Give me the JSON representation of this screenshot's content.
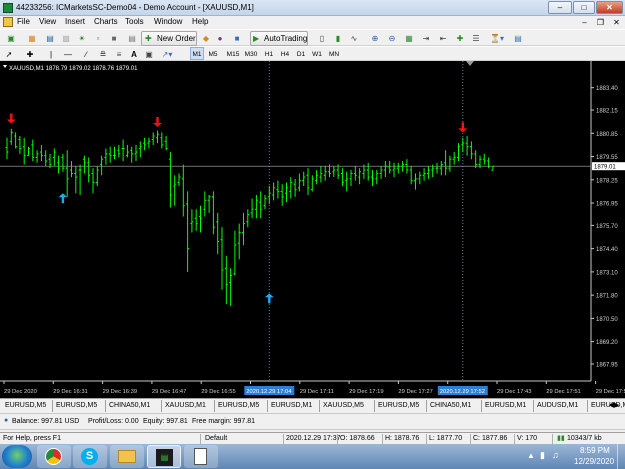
{
  "window": {
    "title": "44233256: ICMarketsSC-Demo04 - Demo Account - [XAUUSD,M1]"
  },
  "menu": [
    "File",
    "View",
    "Insert",
    "Charts",
    "Tools",
    "Window",
    "Help"
  ],
  "toolbar": {
    "new_order": "New Order",
    "autotrading": "AutoTrading",
    "timeframes": [
      "M1",
      "M5",
      "M15",
      "M30",
      "H1",
      "H4",
      "D1",
      "W1",
      "MN"
    ],
    "active_timeframe": "M1"
  },
  "chart_data": {
    "type": "ohlc",
    "title": "XAUUSD,M1  1878.79 1879.02 1878.76 1879.01",
    "colors": {
      "background": "#000000",
      "bars": "#00ff00",
      "grid": "#5a7f9c",
      "up_arrow": "#1ea9f0",
      "down_arrow": "#ff1010",
      "price_line": "#b0b0b0"
    },
    "ylim": [
      1867.0,
      1884.5
    ],
    "y_ticks": [
      "1883.40",
      "1882.15",
      "1880.85",
      "1879.55",
      "1878.25",
      "1876.95",
      "1875.70",
      "1874.40",
      "1873.10",
      "1871.80",
      "1870.50",
      "1869.20",
      "1867.95"
    ],
    "current_price": "1879.01",
    "x_ticks": [
      "29 Dec 2020",
      "29 Dec 16:31",
      "29 Dec 16:39",
      "29 Dec 16:47",
      "29 Dec 16:55",
      "29 Dec 17:03",
      "29 Dec 17:11",
      "29 Dec 17:19",
      "29 Dec 17:27",
      "29 Dec 17:35",
      "29 Dec 17:43",
      "29 Dec 17:51",
      "29 Dec 17:59"
    ],
    "x_highlights": [
      "2020.12.29 17:04",
      "2020.12.29 17:52"
    ],
    "vertical_markers": [
      61,
      106
    ],
    "bars": [
      {
        "o": 1880.05,
        "h": 1880.6,
        "l": 1879.4,
        "c": 1879.8
      },
      {
        "o": 1880.4,
        "h": 1881.1,
        "l": 1880.2,
        "c": 1880.9
      },
      {
        "o": 1880.7,
        "h": 1880.9,
        "l": 1880.0,
        "c": 1880.1
      },
      {
        "o": 1880.5,
        "h": 1880.7,
        "l": 1879.7,
        "c": 1880.0
      },
      {
        "o": 1880.1,
        "h": 1880.6,
        "l": 1879.1,
        "c": 1879.6
      },
      {
        "o": 1879.6,
        "h": 1880.1,
        "l": 1879.6,
        "c": 1880.0
      },
      {
        "o": 1880.2,
        "h": 1880.5,
        "l": 1879.3,
        "c": 1879.5
      },
      {
        "o": 1879.5,
        "h": 1879.9,
        "l": 1879.2,
        "c": 1879.7
      },
      {
        "o": 1879.8,
        "h": 1880.2,
        "l": 1879.3,
        "c": 1879.6
      },
      {
        "o": 1879.6,
        "h": 1879.9,
        "l": 1879.0,
        "c": 1879.3
      },
      {
        "o": 1879.4,
        "h": 1879.7,
        "l": 1878.9,
        "c": 1879.1
      },
      {
        "o": 1879.5,
        "h": 1880.0,
        "l": 1879.0,
        "c": 1879.8
      },
      {
        "o": 1879.2,
        "h": 1879.6,
        "l": 1878.6,
        "c": 1878.9
      },
      {
        "o": 1879.5,
        "h": 1879.7,
        "l": 1878.7,
        "c": 1878.9
      },
      {
        "o": 1878.9,
        "h": 1879.9,
        "l": 1877.3,
        "c": 1878.3
      },
      {
        "o": 1878.8,
        "h": 1879.3,
        "l": 1878.4,
        "c": 1878.6
      },
      {
        "o": 1878.6,
        "h": 1879.0,
        "l": 1877.5,
        "c": 1878.4
      },
      {
        "o": 1878.8,
        "h": 1879.1,
        "l": 1877.4,
        "c": 1878.8
      },
      {
        "o": 1879.4,
        "h": 1879.6,
        "l": 1878.6,
        "c": 1879.2
      },
      {
        "o": 1879.2,
        "h": 1879.5,
        "l": 1878.1,
        "c": 1878.5
      },
      {
        "o": 1878.6,
        "h": 1878.9,
        "l": 1877.5,
        "c": 1878.1
      },
      {
        "o": 1878.1,
        "h": 1879.0,
        "l": 1877.9,
        "c": 1878.8
      },
      {
        "o": 1879.1,
        "h": 1879.6,
        "l": 1878.5,
        "c": 1879.4
      },
      {
        "o": 1879.5,
        "h": 1880.0,
        "l": 1879.1,
        "c": 1879.7
      },
      {
        "o": 1879.7,
        "h": 1880.1,
        "l": 1879.2,
        "c": 1879.6
      },
      {
        "o": 1879.6,
        "h": 1880.1,
        "l": 1879.4,
        "c": 1879.6
      },
      {
        "o": 1879.9,
        "h": 1880.2,
        "l": 1879.5,
        "c": 1879.7
      },
      {
        "o": 1880.0,
        "h": 1880.5,
        "l": 1879.3,
        "c": 1880.0
      },
      {
        "o": 1879.6,
        "h": 1880.2,
        "l": 1879.5,
        "c": 1879.8
      },
      {
        "o": 1879.9,
        "h": 1880.1,
        "l": 1879.2,
        "c": 1879.7
      },
      {
        "o": 1879.7,
        "h": 1880.2,
        "l": 1879.3,
        "c": 1879.8
      },
      {
        "o": 1880.0,
        "h": 1880.4,
        "l": 1879.5,
        "c": 1880.1
      },
      {
        "o": 1880.3,
        "h": 1880.6,
        "l": 1879.9,
        "c": 1880.2
      },
      {
        "o": 1880.3,
        "h": 1880.6,
        "l": 1880.0,
        "c": 1880.4
      },
      {
        "o": 1880.5,
        "h": 1880.9,
        "l": 1880.2,
        "c": 1880.7
      },
      {
        "o": 1880.6,
        "h": 1881.0,
        "l": 1880.3,
        "c": 1880.8
      },
      {
        "o": 1880.6,
        "h": 1880.9,
        "l": 1880.0,
        "c": 1880.2
      },
      {
        "o": 1880.4,
        "h": 1880.7,
        "l": 1879.9,
        "c": 1880.0
      },
      {
        "o": 1879.4,
        "h": 1879.8,
        "l": 1876.7,
        "c": 1877.4
      },
      {
        "o": 1877.9,
        "h": 1878.5,
        "l": 1876.8,
        "c": 1878.0
      },
      {
        "o": 1878.1,
        "h": 1878.6,
        "l": 1877.9,
        "c": 1878.4
      },
      {
        "o": 1878.3,
        "h": 1879.1,
        "l": 1876.2,
        "c": 1876.8
      },
      {
        "o": 1876.9,
        "h": 1877.6,
        "l": 1873.1,
        "c": 1874.4
      },
      {
        "o": 1875.8,
        "h": 1876.6,
        "l": 1875.3,
        "c": 1875.9
      },
      {
        "o": 1876.1,
        "h": 1876.6,
        "l": 1875.4,
        "c": 1875.8
      },
      {
        "o": 1876.2,
        "h": 1876.8,
        "l": 1875.3,
        "c": 1876.1
      },
      {
        "o": 1876.6,
        "h": 1877.6,
        "l": 1876.2,
        "c": 1877.1
      },
      {
        "o": 1877.1,
        "h": 1877.4,
        "l": 1876.4,
        "c": 1877.3
      },
      {
        "o": 1877.3,
        "h": 1877.6,
        "l": 1875.2,
        "c": 1875.6
      },
      {
        "o": 1875.9,
        "h": 1876.4,
        "l": 1874.1,
        "c": 1874.8
      },
      {
        "o": 1874.9,
        "h": 1875.6,
        "l": 1872.1,
        "c": 1873.2
      },
      {
        "o": 1873.3,
        "h": 1874.0,
        "l": 1871.3,
        "c": 1872.4
      },
      {
        "o": 1872.5,
        "h": 1873.3,
        "l": 1871.2,
        "c": 1872.9
      },
      {
        "o": 1873.0,
        "h": 1875.4,
        "l": 1872.9,
        "c": 1874.6
      },
      {
        "o": 1874.7,
        "h": 1875.8,
        "l": 1873.8,
        "c": 1875.3
      },
      {
        "o": 1875.3,
        "h": 1876.4,
        "l": 1874.6,
        "c": 1875.8
      },
      {
        "o": 1875.9,
        "h": 1876.6,
        "l": 1875.6,
        "c": 1876.3
      },
      {
        "o": 1876.4,
        "h": 1877.2,
        "l": 1876.1,
        "c": 1876.6
      },
      {
        "o": 1876.6,
        "h": 1877.4,
        "l": 1876.1,
        "c": 1877.1
      },
      {
        "o": 1877.0,
        "h": 1877.6,
        "l": 1876.1,
        "c": 1876.6
      },
      {
        "o": 1876.8,
        "h": 1877.4,
        "l": 1876.6,
        "c": 1877.2
      },
      {
        "o": 1877.3,
        "h": 1877.9,
        "l": 1876.9,
        "c": 1877.5
      },
      {
        "o": 1877.4,
        "h": 1878.1,
        "l": 1877.1,
        "c": 1877.8
      },
      {
        "o": 1877.7,
        "h": 1878.2,
        "l": 1877.2,
        "c": 1877.6
      },
      {
        "o": 1877.6,
        "h": 1878.0,
        "l": 1876.8,
        "c": 1877.3
      },
      {
        "o": 1877.5,
        "h": 1878.1,
        "l": 1877.0,
        "c": 1877.8
      },
      {
        "o": 1877.6,
        "h": 1878.4,
        "l": 1877.2,
        "c": 1878.1
      },
      {
        "o": 1878.0,
        "h": 1878.3,
        "l": 1877.3,
        "c": 1877.7
      },
      {
        "o": 1877.8,
        "h": 1878.6,
        "l": 1877.6,
        "c": 1878.2
      },
      {
        "o": 1878.2,
        "h": 1878.7,
        "l": 1877.9,
        "c": 1878.4
      },
      {
        "o": 1878.5,
        "h": 1878.9,
        "l": 1877.4,
        "c": 1877.8
      },
      {
        "o": 1877.7,
        "h": 1878.5,
        "l": 1877.6,
        "c": 1878.3
      },
      {
        "o": 1878.2,
        "h": 1878.8,
        "l": 1878.0,
        "c": 1878.5
      },
      {
        "o": 1878.4,
        "h": 1879.0,
        "l": 1878.1,
        "c": 1878.6
      },
      {
        "o": 1878.5,
        "h": 1879.0,
        "l": 1878.2,
        "c": 1878.7
      },
      {
        "o": 1878.7,
        "h": 1879.1,
        "l": 1878.4,
        "c": 1878.6
      },
      {
        "o": 1878.7,
        "h": 1879.0,
        "l": 1878.4,
        "c": 1878.8
      },
      {
        "o": 1878.8,
        "h": 1879.1,
        "l": 1878.3,
        "c": 1878.5
      },
      {
        "o": 1878.6,
        "h": 1878.9,
        "l": 1877.9,
        "c": 1878.1
      },
      {
        "o": 1878.2,
        "h": 1878.7,
        "l": 1877.6,
        "c": 1878.3
      },
      {
        "o": 1878.3,
        "h": 1878.8,
        "l": 1877.9,
        "c": 1878.6
      },
      {
        "o": 1878.6,
        "h": 1879.0,
        "l": 1878.2,
        "c": 1878.5
      },
      {
        "o": 1878.4,
        "h": 1878.9,
        "l": 1878.0,
        "c": 1878.7
      },
      {
        "o": 1878.6,
        "h": 1879.1,
        "l": 1878.3,
        "c": 1878.8
      },
      {
        "o": 1878.8,
        "h": 1879.2,
        "l": 1878.2,
        "c": 1878.4
      },
      {
        "o": 1878.4,
        "h": 1878.8,
        "l": 1877.9,
        "c": 1878.3
      },
      {
        "o": 1878.3,
        "h": 1878.8,
        "l": 1878.0,
        "c": 1878.6
      },
      {
        "o": 1878.6,
        "h": 1879.0,
        "l": 1878.3,
        "c": 1878.8
      },
      {
        "o": 1878.8,
        "h": 1879.3,
        "l": 1878.4,
        "c": 1879.0
      },
      {
        "o": 1879.0,
        "h": 1879.3,
        "l": 1878.6,
        "c": 1878.8
      },
      {
        "o": 1878.8,
        "h": 1879.2,
        "l": 1878.4,
        "c": 1878.9
      },
      {
        "o": 1878.9,
        "h": 1879.2,
        "l": 1878.6,
        "c": 1879.0
      },
      {
        "o": 1879.0,
        "h": 1879.3,
        "l": 1878.7,
        "c": 1879.1
      },
      {
        "o": 1879.1,
        "h": 1879.4,
        "l": 1878.6,
        "c": 1878.8
      },
      {
        "o": 1878.8,
        "h": 1879.0,
        "l": 1878.0,
        "c": 1878.2
      },
      {
        "o": 1878.2,
        "h": 1878.6,
        "l": 1877.7,
        "c": 1878.3
      },
      {
        "o": 1878.3,
        "h": 1878.7,
        "l": 1878.0,
        "c": 1878.5
      },
      {
        "o": 1878.5,
        "h": 1878.9,
        "l": 1878.2,
        "c": 1878.6
      },
      {
        "o": 1878.6,
        "h": 1879.0,
        "l": 1878.3,
        "c": 1878.8
      },
      {
        "o": 1878.8,
        "h": 1879.1,
        "l": 1878.4,
        "c": 1878.9
      },
      {
        "o": 1878.9,
        "h": 1879.2,
        "l": 1878.6,
        "c": 1878.9
      },
      {
        "o": 1878.9,
        "h": 1879.3,
        "l": 1878.5,
        "c": 1879.1
      },
      {
        "o": 1879.2,
        "h": 1879.9,
        "l": 1878.5,
        "c": 1878.9
      },
      {
        "o": 1878.9,
        "h": 1879.6,
        "l": 1878.7,
        "c": 1879.4
      },
      {
        "o": 1879.4,
        "h": 1879.8,
        "l": 1879.1,
        "c": 1879.5
      },
      {
        "o": 1879.5,
        "h": 1880.3,
        "l": 1879.3,
        "c": 1880.1
      },
      {
        "o": 1880.2,
        "h": 1880.6,
        "l": 1879.8,
        "c": 1880.3
      },
      {
        "o": 1880.3,
        "h": 1880.7,
        "l": 1879.6,
        "c": 1880.1
      },
      {
        "o": 1880.1,
        "h": 1880.4,
        "l": 1879.4,
        "c": 1879.7
      },
      {
        "o": 1879.7,
        "h": 1879.9,
        "l": 1878.9,
        "c": 1879.1
      },
      {
        "o": 1879.1,
        "h": 1879.6,
        "l": 1878.9,
        "c": 1879.4
      },
      {
        "o": 1879.4,
        "h": 1879.7,
        "l": 1879.1,
        "c": 1879.3
      },
      {
        "o": 1879.3,
        "h": 1879.5,
        "l": 1878.9,
        "c": 1879.0
      },
      {
        "o": 1878.79,
        "h": 1879.02,
        "l": 1878.76,
        "c": 1879.01
      }
    ],
    "markers": [
      {
        "type": "down",
        "bar": 1,
        "price": 1881.4
      },
      {
        "type": "up",
        "bar": 13,
        "price": 1877.5
      },
      {
        "type": "down",
        "bar": 35,
        "price": 1881.2
      },
      {
        "type": "up",
        "bar": 61,
        "price": 1871.9
      },
      {
        "type": "down",
        "bar": 106,
        "price": 1880.9
      }
    ]
  },
  "chart_tabs": [
    "EURUSD,M5",
    "EURUSD,M5",
    "CHINA50,M1",
    "XAUUSD,M1",
    "EURUSD,M5",
    "EURUSD,M1",
    "XAUUSD,M5",
    "EURUSD,M5",
    "CHINA50,M1",
    "EURUSD,M1",
    "AUDUSD,M1",
    "EURUSD,M1",
    "XAU"
  ],
  "active_tab": 12,
  "account": {
    "balance": "Balance: 997.81 USD",
    "profit": "Profit/Loss: 0.00",
    "equity": "Equity: 997.81",
    "margin": "Free margin: 997.81"
  },
  "statusbar": {
    "help": "For Help, press F1",
    "profile": "Default",
    "time": "2020.12.29 17:37",
    "open": "O: 1878.66",
    "high": "H: 1878.76",
    "low": "L: 1877.70",
    "close": "C: 1877.86",
    "volume": "V: 170",
    "traffic": "10343/7 kb"
  },
  "taskbar": {
    "time": "8:59 PM",
    "date": "12/29/2020"
  }
}
